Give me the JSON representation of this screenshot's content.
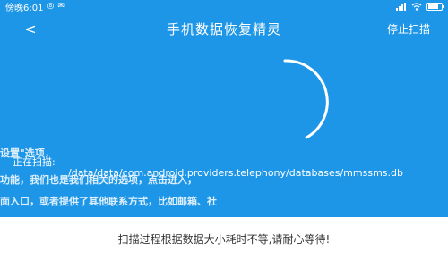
{
  "status_bar": {
    "time": "傍晚6:01"
  },
  "header": {
    "back_label": "<",
    "title": "手机数据恢复精灵",
    "stop_label": "停止扫描"
  },
  "scan": {
    "label": "正在扫描:",
    "path": "/data/data/com.android.providers.telephony/databases/mmssms.db",
    "ghost_lines": [
      "设置\"选项，",
      "功能，我们也是我们相关的选项，点击进入，",
      "面入口，或者提供了其他联系方式，比如邮箱、社"
    ]
  },
  "footer": {
    "tip": "扫描过程根据数据大小耗时不等,请耐心等待!"
  },
  "colors": {
    "background": "#1e96e8",
    "panel": "#ffffff",
    "text_dark": "#333333"
  }
}
